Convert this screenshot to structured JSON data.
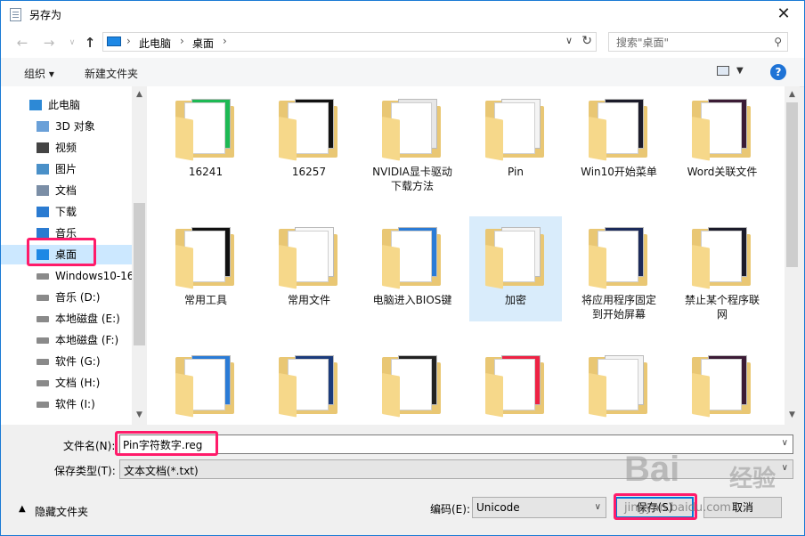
{
  "window": {
    "title": "另存为",
    "close": "✕"
  },
  "address": {
    "crumbs": [
      "此电脑",
      "桌面"
    ]
  },
  "search": {
    "placeholder": "搜索\"桌面\""
  },
  "toolbar": {
    "organize": "组织 ▾",
    "new_folder": "新建文件夹",
    "help": "?"
  },
  "sidebar": {
    "items": [
      {
        "label": "此电脑",
        "icon": "computer-icon"
      },
      {
        "label": "3D 对象",
        "icon": "cube-icon"
      },
      {
        "label": "视频",
        "icon": "video-icon"
      },
      {
        "label": "图片",
        "icon": "picture-icon"
      },
      {
        "label": "文档",
        "icon": "document-icon"
      },
      {
        "label": "下载",
        "icon": "download-icon"
      },
      {
        "label": "音乐",
        "icon": "music-icon"
      },
      {
        "label": "桌面",
        "icon": "desktop-icon"
      },
      {
        "label": "Windows10-16",
        "icon": "drive-icon"
      },
      {
        "label": "音乐 (D:)",
        "icon": "drive-icon"
      },
      {
        "label": "本地磁盘 (E:)",
        "icon": "drive-icon"
      },
      {
        "label": "本地磁盘 (F:)",
        "icon": "drive-icon"
      },
      {
        "label": "软件 (G:)",
        "icon": "drive-icon"
      },
      {
        "label": "文档 (H:)",
        "icon": "drive-icon"
      },
      {
        "label": "软件 (I:)",
        "icon": "drive-icon"
      }
    ]
  },
  "folders": [
    [
      "16241"
    ],
    [
      "16257"
    ],
    [
      "NVIDIA显卡驱动",
      "下载方法"
    ],
    [
      "Pin"
    ],
    [
      "Win10开始菜单"
    ],
    [
      "Word关联文件"
    ],
    [
      "常用工具"
    ],
    [
      "常用文件"
    ],
    [
      "电脑进入BIOS键"
    ],
    [
      "加密"
    ],
    [
      "将应用程序固定",
      "到开始屏幕"
    ],
    [
      "禁止某个程序联",
      "网"
    ],
    [
      ""
    ],
    [
      ""
    ],
    [
      ""
    ],
    [
      ""
    ],
    [
      ""
    ],
    [
      ""
    ]
  ],
  "form": {
    "filename_label": "文件名(N):",
    "filename_value": "Pin字符数字.reg",
    "filetype_label": "保存类型(T):",
    "filetype_value": "文本文档(*.txt)",
    "hide_folders": "隐藏文件夹",
    "encoding_label": "编码(E):",
    "encoding_value": "Unicode",
    "save": "保存(S)",
    "cancel": "取消"
  },
  "watermark": {
    "brand": "Bai",
    "brand_cn": "经验",
    "url": "jingyan.baidu.com"
  },
  "colors": {
    "accent": "#0078d7",
    "highlight": "#ff1b6a",
    "folder": "#e9c774",
    "selected": "#cce8ff"
  }
}
